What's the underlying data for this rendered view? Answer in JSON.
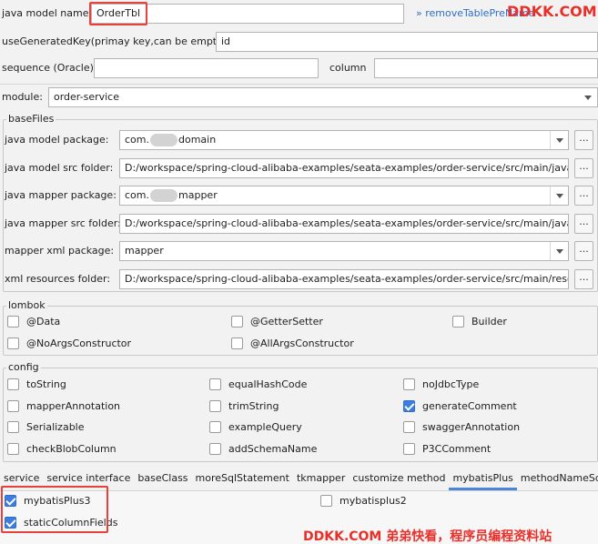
{
  "top": {
    "model_name_label": "java model name:",
    "model_name_value": "OrderTbl",
    "remove_prefix_link": "removeTablePreName",
    "generated_key_label": "useGeneratedKey(primay key,can be empty):",
    "generated_key_value": "id",
    "sequence_label": "sequence (Oracle)",
    "sequence_value": "",
    "column_label": "column",
    "column_value": ""
  },
  "module": {
    "label": "module:",
    "value": "order-service"
  },
  "baseFiles": {
    "title": "baseFiles",
    "model_package_label": "java model package:",
    "model_package_prefix": "com.",
    "model_package_suffix": "domain",
    "model_src_label": "java model src folder:",
    "model_src_value": "D:/workspace/spring-cloud-alibaba-examples/seata-examples/order-service/src/main/java",
    "mapper_package_label": "java mapper package:",
    "mapper_package_prefix": "com.",
    "mapper_package_suffix": "mapper",
    "mapper_src_label": "java mapper src folder:",
    "mapper_src_value": "D:/workspace/spring-cloud-alibaba-examples/seata-examples/order-service/src/main/java",
    "xml_package_label": "mapper xml package:",
    "xml_package_value": "mapper",
    "xml_folder_label": "xml resources folder:",
    "xml_folder_value": "D:/workspace/spring-cloud-alibaba-examples/seata-examples/order-service/src/main/resources",
    "browse_label": "..."
  },
  "lombok": {
    "title": "lombok",
    "items": [
      {
        "label": "@Data",
        "checked": false
      },
      {
        "label": "@GetterSetter",
        "checked": false
      },
      {
        "label": "Builder",
        "checked": false
      },
      {
        "label": "@NoArgsConstructor",
        "checked": false
      },
      {
        "label": "@AllArgsConstructor",
        "checked": false
      }
    ]
  },
  "config": {
    "title": "config",
    "items": [
      {
        "label": "toString",
        "checked": false
      },
      {
        "label": "equalHashCode",
        "checked": false
      },
      {
        "label": "noJdbcType",
        "checked": false
      },
      {
        "label": "mapperAnnotation",
        "checked": false
      },
      {
        "label": "trimString",
        "checked": false
      },
      {
        "label": "generateComment",
        "checked": true
      },
      {
        "label": "Serializable",
        "checked": false
      },
      {
        "label": "exampleQuery",
        "checked": false
      },
      {
        "label": "swaggerAnnotation",
        "checked": false
      },
      {
        "label": "checkBlobColumn",
        "checked": false
      },
      {
        "label": "addSchemaName",
        "checked": false
      },
      {
        "label": "P3CComment",
        "checked": false
      }
    ]
  },
  "tabs": [
    "service",
    "service interface",
    "baseClass",
    "moreSqlStatement",
    "tkmapper",
    "customize method",
    "mybatisPlus",
    "methodNameSql"
  ],
  "active_tab": "mybatisPlus",
  "mybatisPlus": {
    "items": [
      {
        "label": "mybatisPlus3",
        "checked": true
      },
      {
        "label": "mybatisplus2",
        "checked": false
      },
      {
        "label": "staticColumnFields",
        "checked": true
      }
    ]
  },
  "watermarks": {
    "top_right": "DDKK.COM",
    "bottom": "DDKK.COM 弟弟快看，程序员编程资料站"
  },
  "colors": {
    "accent": "#3c7ee0",
    "highlight_box": "#e8403a",
    "watermark": "#e8302a"
  }
}
